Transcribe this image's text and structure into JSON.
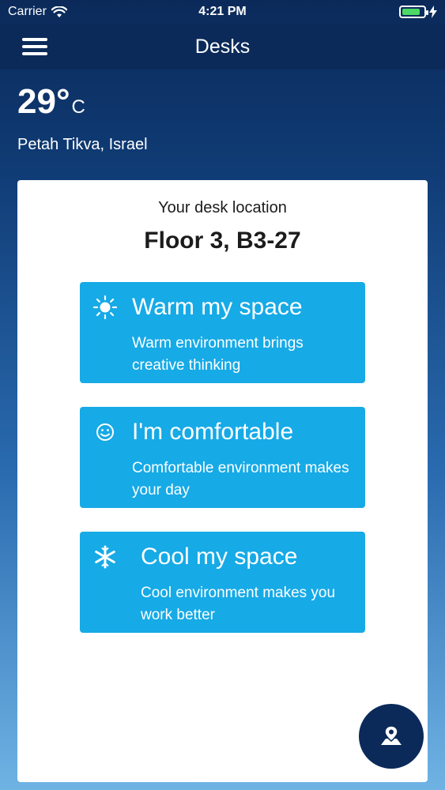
{
  "status_bar": {
    "carrier": "Carrier",
    "time": "4:21 PM",
    "battery_level": 0.85
  },
  "nav": {
    "title": "Desks",
    "menu_icon": "hamburger-icon"
  },
  "weather": {
    "temperature": "29°",
    "unit": "C",
    "location": "Petah Tikva, Israel"
  },
  "desk": {
    "caption": "Your desk location",
    "value": "Floor 3, B3-27"
  },
  "options": [
    {
      "icon": "sun-icon",
      "title": "Warm my space",
      "description": "Warm environment brings creative thinking"
    },
    {
      "icon": "smiley-icon",
      "title": "I'm comfortable",
      "description": "Comfortable environment makes your day"
    },
    {
      "icon": "snowflake-icon",
      "title": "Cool my space",
      "description": "Cool environment makes you work better"
    }
  ],
  "fab": {
    "icon": "map-pin-icon"
  },
  "colors": {
    "nav_background": "#0b2a5a",
    "option_background": "#16aae6",
    "battery_fill": "#4cd964"
  }
}
